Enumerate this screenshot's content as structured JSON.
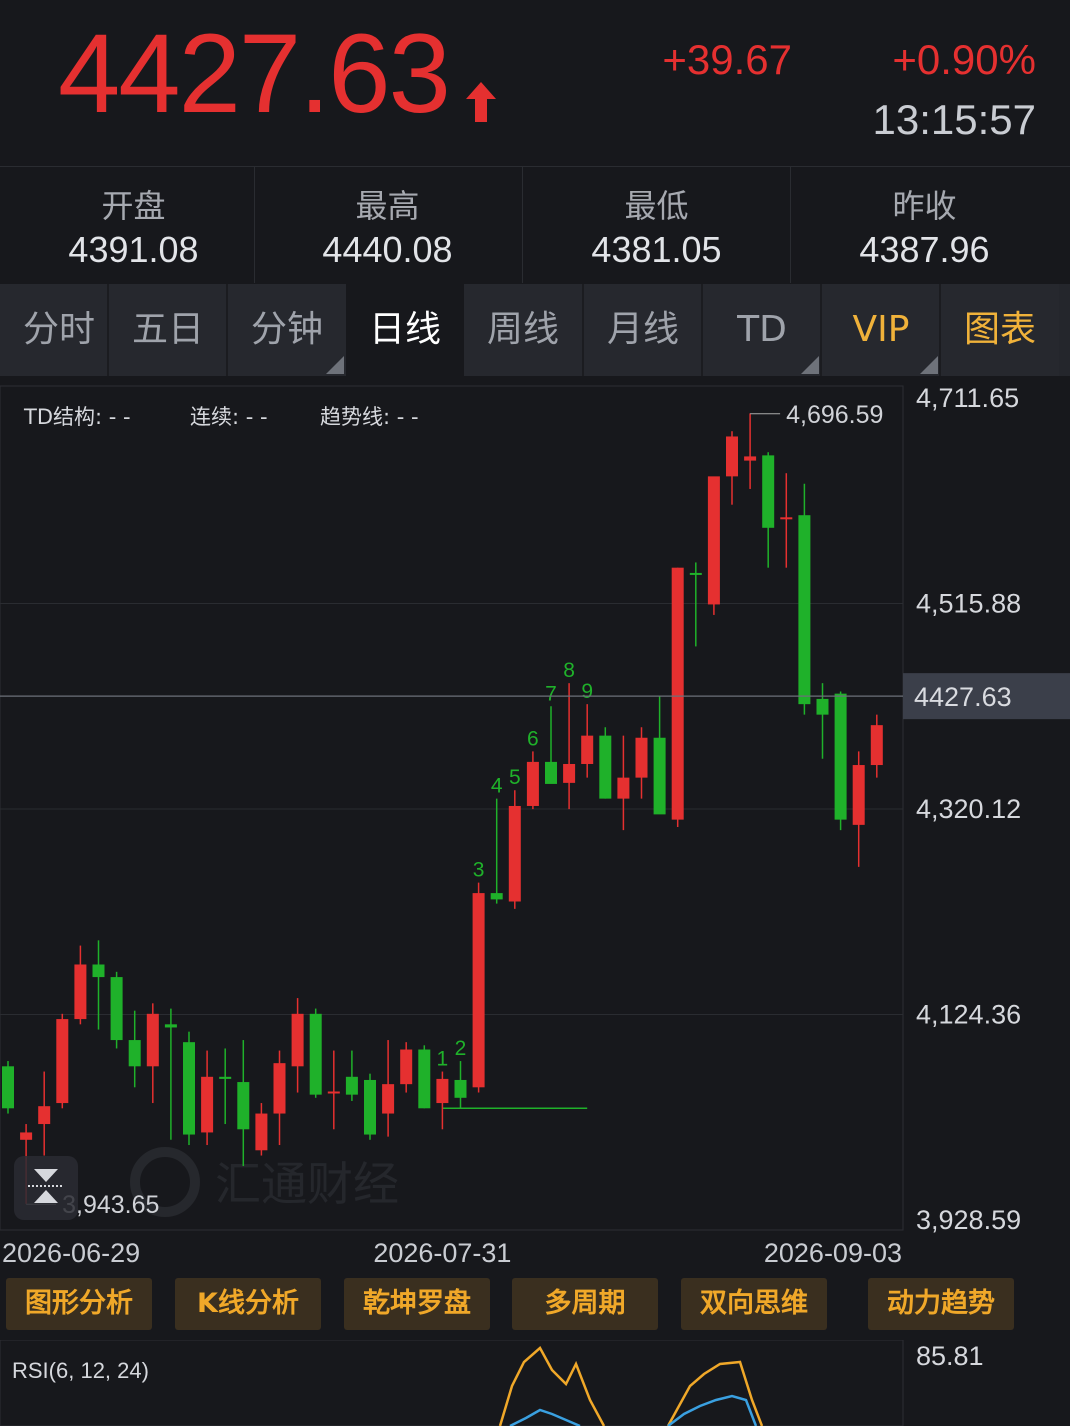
{
  "header": {
    "price": "4427.63",
    "change": "+39.67",
    "change_pct": "+0.90%",
    "time": "13:15:57",
    "up_color": "#e53030",
    "down_color": "#1fb12a"
  },
  "stats": [
    {
      "label": "开盘",
      "value": "4391.08"
    },
    {
      "label": "最高",
      "value": "4440.08"
    },
    {
      "label": "最低",
      "value": "4381.05"
    },
    {
      "label": "昨收",
      "value": "4387.96"
    }
  ],
  "tabs": [
    "分时",
    "五日",
    "分钟",
    "日线",
    "周线",
    "月线",
    "TD",
    "VIP",
    "图表"
  ],
  "active_tab": "日线",
  "analysis_buttons": [
    "图形分析",
    "K线分析",
    "乾坤罗盘",
    "多周期",
    "双向思维",
    "动力趋势"
  ],
  "watermark": "汇通财经",
  "chart_data": {
    "type": "candlestick",
    "td_info": {
      "structure": "TD结构: - -",
      "continuous": "连续: - -",
      "trendline": "趋势线: - -"
    },
    "y_ticks": [
      "4,711.65",
      "4,515.88",
      "4,320.12",
      "4,124.36",
      "3,928.59"
    ],
    "y_tick_values": [
      4711.65,
      4515.88,
      4320.12,
      4124.36,
      3928.59
    ],
    "x_ticks": [
      "2026-06-29",
      "2026-07-31",
      "2026-09-03"
    ],
    "x_tick_index": [
      0,
      24,
      44
    ],
    "current_price_label": "4427.63",
    "current_price": 4427.63,
    "max_label": "4,696.59",
    "max_value": 4696.59,
    "min_label": "3,943.65",
    "min_value": 3943.65,
    "td_counts": [
      "1",
      "2",
      "3",
      "4",
      "5",
      "6",
      "7",
      "8",
      "9"
    ],
    "td_count_index": [
      24,
      25,
      26,
      27,
      28,
      29,
      30,
      31,
      32
    ],
    "candles": [
      {
        "o": 4075,
        "h": 4080,
        "l": 4030,
        "c": 4035
      },
      {
        "o": 4005,
        "h": 4020,
        "l": 3944,
        "c": 4012
      },
      {
        "o": 4020,
        "h": 4070,
        "l": 3990,
        "c": 4037
      },
      {
        "o": 4040,
        "h": 4125,
        "l": 4035,
        "c": 4120
      },
      {
        "o": 4120,
        "h": 4190,
        "l": 4115,
        "c": 4172
      },
      {
        "o": 4172,
        "h": 4195,
        "l": 4110,
        "c": 4160
      },
      {
        "o": 4160,
        "h": 4165,
        "l": 4092,
        "c": 4100
      },
      {
        "o": 4100,
        "h": 4128,
        "l": 4055,
        "c": 4075
      },
      {
        "o": 4075,
        "h": 4135,
        "l": 4040,
        "c": 4125
      },
      {
        "o": 4115,
        "h": 4130,
        "l": 4005,
        "c": 4112
      },
      {
        "o": 4098,
        "h": 4108,
        "l": 4000,
        "c": 4010
      },
      {
        "o": 4012,
        "h": 4090,
        "l": 4000,
        "c": 4065
      },
      {
        "o": 4065,
        "h": 4092,
        "l": 4020,
        "c": 4063
      },
      {
        "o": 4060,
        "h": 4100,
        "l": 3980,
        "c": 4015
      },
      {
        "o": 3995,
        "h": 4040,
        "l": 3990,
        "c": 4030
      },
      {
        "o": 4030,
        "h": 4090,
        "l": 4000,
        "c": 4078
      },
      {
        "o": 4075,
        "h": 4140,
        "l": 4050,
        "c": 4125
      },
      {
        "o": 4125,
        "h": 4130,
        "l": 4045,
        "c": 4048
      },
      {
        "o": 4050,
        "h": 4090,
        "l": 4015,
        "c": 4051
      },
      {
        "o": 4065,
        "h": 4090,
        "l": 4042,
        "c": 4048
      },
      {
        "o": 4062,
        "h": 4068,
        "l": 4005,
        "c": 4010
      },
      {
        "o": 4030,
        "h": 4100,
        "l": 4008,
        "c": 4058
      },
      {
        "o": 4058,
        "h": 4098,
        "l": 4050,
        "c": 4091
      },
      {
        "o": 4091,
        "h": 4095,
        "l": 4035,
        "c": 4035
      },
      {
        "o": 4040,
        "h": 4070,
        "l": 4015,
        "c": 4063
      },
      {
        "o": 4062,
        "h": 4080,
        "l": 4035,
        "c": 4045
      },
      {
        "o": 4055,
        "h": 4250,
        "l": 4050,
        "c": 4240
      },
      {
        "o": 4240,
        "h": 4330,
        "l": 4230,
        "c": 4234
      },
      {
        "o": 4232,
        "h": 4338,
        "l": 4225,
        "c": 4323
      },
      {
        "o": 4323,
        "h": 4375,
        "l": 4320,
        "c": 4365
      },
      {
        "o": 4365,
        "h": 4418,
        "l": 4345,
        "c": 4344
      },
      {
        "o": 4345,
        "h": 4440,
        "l": 4320,
        "c": 4363
      },
      {
        "o": 4363,
        "h": 4420,
        "l": 4350,
        "c": 4390
      },
      {
        "o": 4390,
        "h": 4398,
        "l": 4330,
        "c": 4330
      },
      {
        "o": 4330,
        "h": 4390,
        "l": 4300,
        "c": 4350
      },
      {
        "o": 4350,
        "h": 4398,
        "l": 4330,
        "c": 4388
      },
      {
        "o": 4388,
        "h": 4428,
        "l": 4320,
        "c": 4315
      },
      {
        "o": 4310,
        "h": 4550,
        "l": 4303,
        "c": 4550
      },
      {
        "o": 4545,
        "h": 4555,
        "l": 4475,
        "c": 4544
      },
      {
        "o": 4515,
        "h": 4582,
        "l": 4505,
        "c": 4637
      },
      {
        "o": 4637,
        "h": 4680,
        "l": 4610,
        "c": 4675
      },
      {
        "o": 4652,
        "h": 4697,
        "l": 4625,
        "c": 4656
      },
      {
        "o": 4657,
        "h": 4660,
        "l": 4550,
        "c": 4588
      },
      {
        "o": 4598,
        "h": 4640,
        "l": 4550,
        "c": 4598
      },
      {
        "o": 4600,
        "h": 4630,
        "l": 4410,
        "c": 4420
      },
      {
        "o": 4425,
        "h": 4440,
        "l": 4368,
        "c": 4410
      },
      {
        "o": 4430,
        "h": 4432,
        "l": 4300,
        "c": 4310
      },
      {
        "o": 4305,
        "h": 4375,
        "l": 4265,
        "c": 4362
      },
      {
        "o": 4362,
        "h": 4410,
        "l": 4350,
        "c": 4400
      }
    ],
    "support_line": {
      "value": 4035,
      "from_index": 24,
      "to_index": 32
    }
  },
  "rsi": {
    "label": "RSI(6, 12, 24)",
    "max_label": "85.81",
    "colors": [
      "#f0a829",
      "#3aa0e0"
    ]
  }
}
